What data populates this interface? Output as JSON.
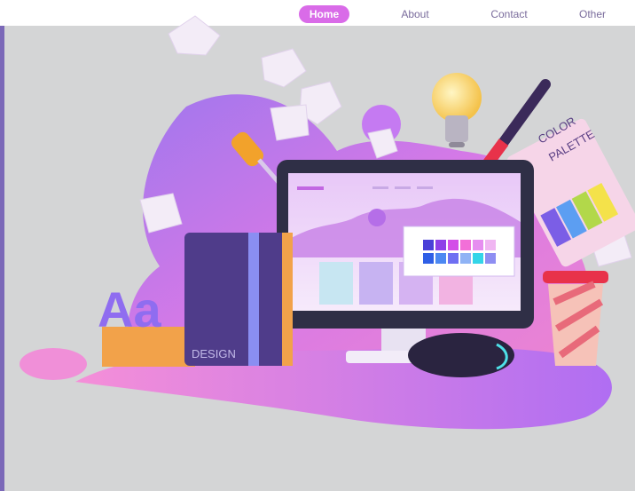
{
  "nav": {
    "items": [
      {
        "label": "Home",
        "active": true
      },
      {
        "label": "About",
        "active": false
      },
      {
        "label": "Contact",
        "active": false
      },
      {
        "label": "Other",
        "active": false
      }
    ]
  },
  "illustration": {
    "book_label": "DESIGN",
    "palette_label_line1": "COLOR",
    "palette_label_line2": "PALETTE",
    "letters": "Aa"
  },
  "colors": {
    "accent": "#d96be8",
    "nav_text": "#7a6c9c",
    "background": "#d4d5d6",
    "left_bar": "#7b68b8"
  }
}
